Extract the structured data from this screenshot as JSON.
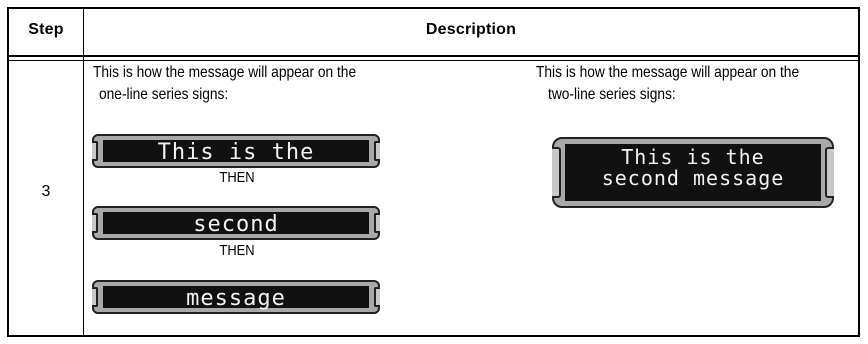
{
  "header": {
    "step": "Step",
    "description": "Description"
  },
  "row": {
    "step": "3",
    "left_intro_1": "This is how the message will appear on the",
    "left_intro_2": "one-line series signs:",
    "right_intro_1": "This is how the message will appear on the",
    "right_intro_2": "two-line series signs:",
    "then": "THEN",
    "one_line_signs": [
      "This is the",
      "second",
      "message"
    ],
    "two_line_sign": [
      "This is the",
      "second message"
    ]
  }
}
